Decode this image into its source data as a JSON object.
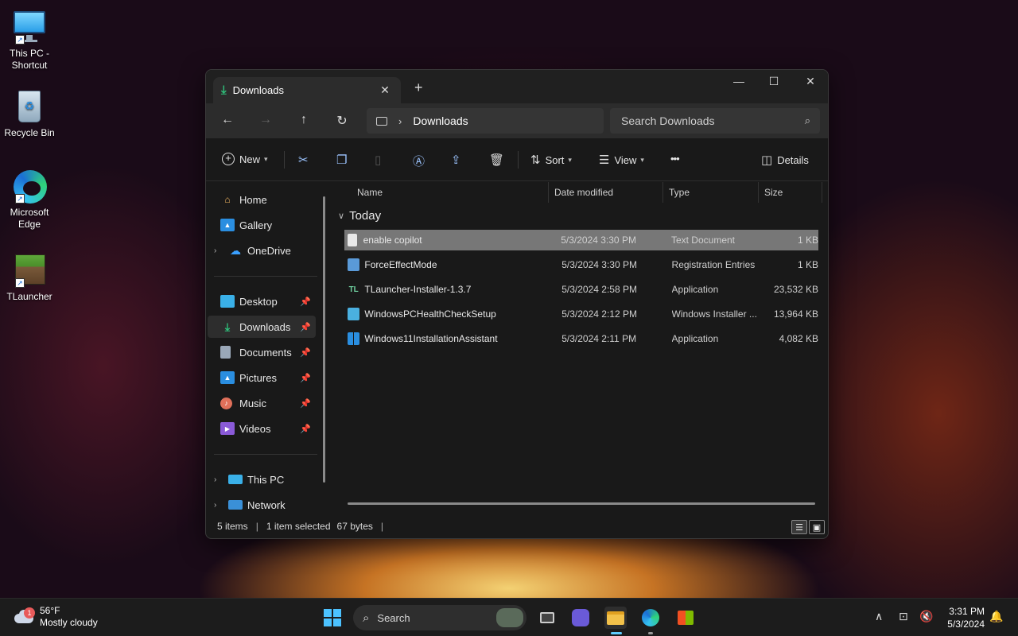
{
  "desktop": {
    "icons": [
      {
        "label": "This PC - Shortcut"
      },
      {
        "label": "Recycle Bin"
      },
      {
        "label": "Microsoft Edge"
      },
      {
        "label": "TLauncher"
      }
    ]
  },
  "window": {
    "tab_title": "Downloads",
    "tab_close": "✕",
    "new_tab": "+",
    "controls": {
      "minimize": "—",
      "maximize": "☐",
      "close": "✕"
    },
    "nav": {
      "back": "←",
      "forward": "→",
      "up": "↑",
      "refresh": "↻"
    },
    "address": {
      "separator": "›",
      "current": "Downloads"
    },
    "search": {
      "placeholder": "Search Downloads"
    },
    "commands": {
      "new": "New",
      "sort": "Sort",
      "view": "View",
      "more": "•••",
      "details": "Details"
    },
    "sidebar": {
      "items": [
        {
          "label": "Home"
        },
        {
          "label": "Gallery"
        },
        {
          "label": "OneDrive"
        },
        {
          "label": "Desktop"
        },
        {
          "label": "Downloads"
        },
        {
          "label": "Documents"
        },
        {
          "label": "Pictures"
        },
        {
          "label": "Music"
        },
        {
          "label": "Videos"
        },
        {
          "label": "This PC"
        },
        {
          "label": "Network"
        }
      ]
    },
    "columns": {
      "name": "Name",
      "date": "Date modified",
      "type": "Type",
      "size": "Size"
    },
    "group": "Today",
    "files": [
      {
        "name": "enable copilot",
        "date": "5/3/2024 3:30 PM",
        "type": "Text Document",
        "size": "1 KB"
      },
      {
        "name": "ForceEffectMode",
        "date": "5/3/2024 3:30 PM",
        "type": "Registration Entries",
        "size": "1 KB"
      },
      {
        "name": "TLauncher-Installer-1.3.7",
        "date": "5/3/2024 2:58 PM",
        "type": "Application",
        "size": "23,532 KB"
      },
      {
        "name": "WindowsPCHealthCheckSetup",
        "date": "5/3/2024 2:12 PM",
        "type": "Windows Installer ...",
        "size": "13,964 KB"
      },
      {
        "name": "Windows11InstallationAssistant",
        "date": "5/3/2024 2:11 PM",
        "type": "Application",
        "size": "4,082 KB"
      }
    ],
    "status": {
      "items": "5 items",
      "selected": "1 item selected",
      "bytes": "67 bytes",
      "bar": "|"
    }
  },
  "taskbar": {
    "weather": {
      "temp": "56°F",
      "desc": "Mostly cloudy",
      "badge": "1"
    },
    "search_label": "Search",
    "clock": {
      "time": "3:31 PM",
      "date": "5/3/2024"
    }
  },
  "colors": {
    "accent": "#60cdff",
    "selection": "#777777",
    "window_bg": "#191919"
  }
}
